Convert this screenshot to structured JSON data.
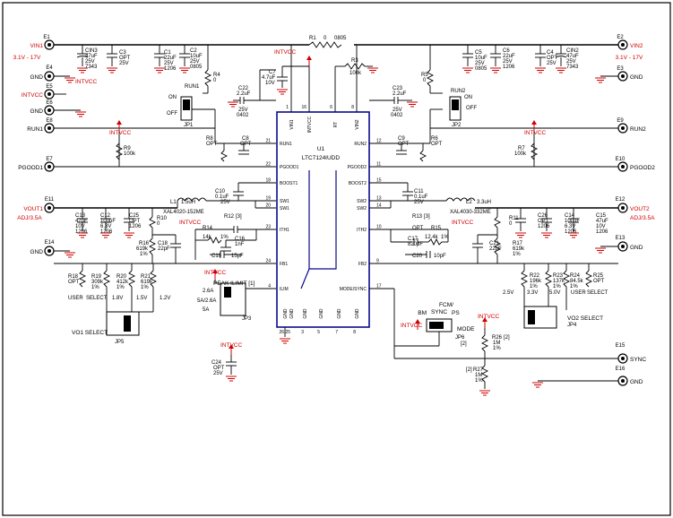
{
  "ic": {
    "ref": "U1",
    "part": "LTC7124IUDD"
  },
  "ic_pins_left": [
    {
      "num": "21",
      "name": "RUN1"
    },
    {
      "num": "22",
      "name": "PGOOD1"
    },
    {
      "num": "18",
      "name": "BOOST1"
    },
    {
      "num": "19",
      "name": "SW1"
    },
    {
      "num": "20",
      "name": "SW1"
    },
    {
      "num": "23",
      "name": "ITH1"
    },
    {
      "num": "24",
      "name": "FB1"
    },
    {
      "num": "4",
      "name": "ILIM"
    }
  ],
  "ic_pins_right": [
    {
      "num": "12",
      "name": "RUN2"
    },
    {
      "num": "11",
      "name": "PGOOD2"
    },
    {
      "num": "15",
      "name": "BOOST2"
    },
    {
      "num": "13",
      "name": "SW2"
    },
    {
      "num": "14",
      "name": "SW2"
    },
    {
      "num": "10",
      "name": "ITH2"
    },
    {
      "num": "9",
      "name": "FB2"
    },
    {
      "num": "17",
      "name": "MODE/SYNC"
    }
  ],
  "ic_pins_top": [
    {
      "num": "1",
      "name": "VIN1"
    },
    {
      "num": "16",
      "name": "INTVCC"
    },
    {
      "num": "6",
      "name": "RT"
    },
    {
      "num": "8",
      "name": "VIN2"
    }
  ],
  "ic_pins_bottom": [
    {
      "num": "26",
      "name": "GND"
    },
    {
      "num": "25",
      "name": "GND"
    },
    {
      "num": "3",
      "name": "GND"
    },
    {
      "num": "5",
      "name": "GND"
    },
    {
      "num": "7",
      "name": "GND"
    },
    {
      "num": "8",
      "name": "GND"
    }
  ],
  "terminals_left": [
    {
      "ref": "E1",
      "label": "VIN1",
      "sub": "3.1V - 17V"
    },
    {
      "ref": "E4",
      "label": "GND"
    },
    {
      "ref": "E5",
      "label": "INTVCC"
    },
    {
      "ref": "E6",
      "label": "GND"
    },
    {
      "ref": "E8",
      "label": "RUN1"
    },
    {
      "ref": "E7",
      "label": "PGOOD1"
    },
    {
      "ref": "E11",
      "label": "VOUT1",
      "sub": "ADJ/3.5A"
    },
    {
      "ref": "E14",
      "label": "GND"
    }
  ],
  "terminals_right": [
    {
      "ref": "E2",
      "label": "VIN2",
      "sub": "3.1V - 17V"
    },
    {
      "ref": "E3",
      "label": "GND"
    },
    {
      "ref": "E9",
      "label": "RUN2"
    },
    {
      "ref": "E10",
      "label": "PGOOD2"
    },
    {
      "ref": "E12",
      "label": "VOUT2",
      "sub": "ADJ/3.5A"
    },
    {
      "ref": "E13",
      "label": "GND"
    },
    {
      "ref": "E15",
      "label": "SYNC"
    },
    {
      "ref": "E16",
      "label": "GND"
    }
  ],
  "net_intvcc": "INTVCC",
  "components": {
    "cin3": [
      "CIN3",
      "47uF",
      "25V",
      "7343"
    ],
    "c3": [
      "C3",
      "OPT",
      "25V"
    ],
    "c1": [
      "C1",
      "22uF",
      "25V",
      "1206"
    ],
    "c2": [
      "C2",
      "10uF",
      "25V",
      "0805"
    ],
    "r4": [
      "R4",
      "0"
    ],
    "r1": [
      "R1",
      "0",
      "0805"
    ],
    "c7": [
      "C7",
      "4.7uF",
      "10V"
    ],
    "r3": [
      "R3",
      "100k"
    ],
    "c22": [
      "C22",
      "2.2uF",
      "25V",
      "0402"
    ],
    "c23": [
      "C23",
      "2.2uF",
      "25V",
      "0402"
    ],
    "r5": [
      "R5",
      "0"
    ],
    "c5": [
      "C5",
      "10uF",
      "25V",
      "0805"
    ],
    "c6": [
      "C6",
      "22uF",
      "25V",
      "1206"
    ],
    "c4": [
      "C4",
      "OPT",
      "25V"
    ],
    "cin2": [
      "CIN2",
      "47uF",
      "25V",
      "7343"
    ],
    "run1": [
      "RUN1",
      "ON",
      "OFF",
      "JP1"
    ],
    "run2": [
      "RUN2",
      "ON",
      "OFF",
      "JP2"
    ],
    "r8": [
      "R8",
      "OPT"
    ],
    "c8": [
      "C8",
      "OPT"
    ],
    "r9": [
      "R9",
      "100k"
    ],
    "c9": [
      "C9",
      "OPT"
    ],
    "r6": [
      "R6",
      "OPT"
    ],
    "r7": [
      "R7",
      "100k"
    ],
    "c10": [
      "C10",
      "0.1uF",
      "25V"
    ],
    "l1": [
      "L1",
      "1.5uH",
      "XAL4020-152ME"
    ],
    "c11": [
      "C11",
      "0.1uF",
      "25V"
    ],
    "l2": [
      "L2",
      "3.3uH",
      "XAL4030-332ME"
    ],
    "c13": [
      "C13",
      "47uF",
      "10V",
      "1206"
    ],
    "c12": [
      "C12",
      "100uF",
      "6.3V",
      "1206"
    ],
    "c25": [
      "C25",
      "OPT",
      "1206"
    ],
    "r10": [
      "R10",
      "0"
    ],
    "r12": [
      "R12",
      "[3]"
    ],
    "r14": [
      "R14",
      "14k",
      "1%"
    ],
    "c16": [
      "C16",
      "1nF"
    ],
    "c19": [
      "C19",
      "15pF"
    ],
    "r13": [
      "R13",
      "[3]",
      "OPT"
    ],
    "c17": [
      "C17",
      "820pF"
    ],
    "r15": [
      "R15",
      "12.4k",
      "1%"
    ],
    "c20": [
      "C20",
      "10pF"
    ],
    "r11": [
      "R11",
      "0"
    ],
    "c26": [
      "C26",
      "OPT",
      "1206"
    ],
    "c14": [
      "C14",
      "100uF",
      "6.3V",
      "1206"
    ],
    "c15": [
      "C15",
      "47uF",
      "10V",
      "1206"
    ],
    "r16": [
      "R16",
      "619k",
      "1%"
    ],
    "c18": [
      "C18",
      "22pF"
    ],
    "c21": [
      "C21",
      "22pF"
    ],
    "r17": [
      "R17",
      "619k",
      "1%"
    ],
    "r18": [
      "R18",
      "OPT"
    ],
    "r19": [
      "R19",
      "309k",
      "1%"
    ],
    "r20": [
      "R20",
      "412k",
      "1%"
    ],
    "r21": [
      "R21",
      "619k",
      "1%"
    ],
    "r22": [
      "R22",
      "196k",
      "1%"
    ],
    "r23": [
      "R23",
      "137k",
      "1%"
    ],
    "r24": [
      "R24",
      "84.5k",
      "1%"
    ],
    "r25": [
      "R25",
      "OPT"
    ],
    "r26": [
      "R26",
      "1M",
      "1%",
      "[2]"
    ],
    "r27": [
      "R27",
      "1M",
      "1%",
      "[2]"
    ],
    "c24": [
      "C24",
      "OPT",
      "25V"
    ]
  },
  "jp3": {
    "title": "PEAK ILIMIT [1]",
    "ref": "JP3",
    "rows": [
      "2.6A",
      "5A/2.6A",
      "5A"
    ]
  },
  "jp5": {
    "title": "VO1 SELECT",
    "ref": "JP5",
    "labels": [
      "USER",
      "SELECT",
      "1.8V",
      "1.5V",
      "1.2V"
    ]
  },
  "jp4": {
    "title": "VO2 SELECT",
    "ref": "JP4",
    "labels": [
      "2.5V",
      "3.3V",
      "5.0V",
      "USER",
      "SELECT"
    ]
  },
  "jp6": {
    "title": "FCM/",
    "title2": "SYNC",
    "ref": "JP6",
    "opts": [
      "BM",
      "PS"
    ],
    "mode": "MODE",
    "note": "[2]"
  },
  "colors": {
    "wire": "#000000",
    "power": "#d00000",
    "chip": "#0a0a8c"
  }
}
